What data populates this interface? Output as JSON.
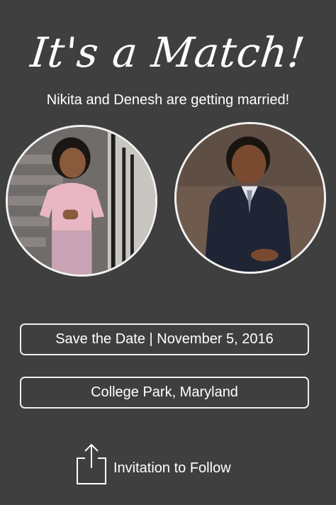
{
  "header": {
    "title": "It's a Match!",
    "subtitle": "Nikita and Denesh are getting married!"
  },
  "photos": [
    {
      "subject": "girl-childhood-photo"
    },
    {
      "subject": "boy-childhood-photo"
    }
  ],
  "event": {
    "save_the_date": "Save the Date | November 5, 2016",
    "location": "College Park, Maryland"
  },
  "footer": {
    "follow_label": "Invitation to Follow",
    "icon": "share-icon"
  },
  "colors": {
    "background": "#3f3f3f",
    "text": "#ffffff",
    "border": "#eeeeee"
  }
}
